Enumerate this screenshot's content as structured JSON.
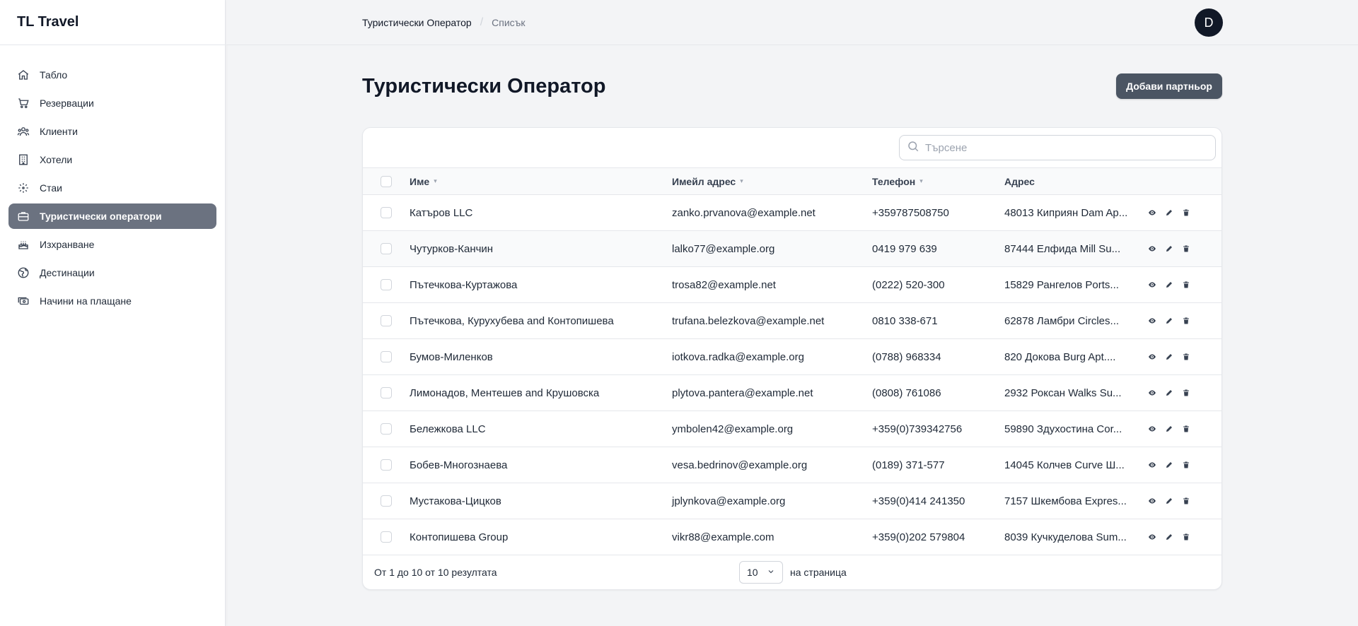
{
  "app": {
    "brand": "TL Travel"
  },
  "sidebar": {
    "items": [
      {
        "label": "Табло",
        "icon": "home-icon",
        "active": false
      },
      {
        "label": "Резервации",
        "icon": "cart-icon",
        "active": false
      },
      {
        "label": "Клиенти",
        "icon": "users-icon",
        "active": false
      },
      {
        "label": "Хотели",
        "icon": "building-icon",
        "active": false
      },
      {
        "label": "Стаи",
        "icon": "rooms-icon",
        "active": false
      },
      {
        "label": "Туристически оператори",
        "icon": "briefcase-icon",
        "active": true
      },
      {
        "label": "Изхранване",
        "icon": "cake-icon",
        "active": false
      },
      {
        "label": "Дестинации",
        "icon": "globe-icon",
        "active": false
      },
      {
        "label": "Начини на плащане",
        "icon": "cash-icon",
        "active": false
      }
    ]
  },
  "header": {
    "breadcrumb": [
      "Туристически Оператор",
      "Списък"
    ],
    "avatar_initial": "D"
  },
  "page": {
    "title": "Туристически Оператор",
    "add_button": "Добави партньор"
  },
  "table": {
    "search_placeholder": "Търсене",
    "columns": [
      "Име",
      "Имейл адрес",
      "Телефон",
      "Адрес"
    ],
    "rows": [
      {
        "name": "Катъров LLC",
        "email": "zanko.prvanova@example.net",
        "phone": "+359787508750",
        "address": "48013 Киприян Dam Ap..."
      },
      {
        "name": "Чутурков-Канчин",
        "email": "lalko77@example.org",
        "phone": "0419 979 639",
        "address": "87444 Елфида Mill Su..."
      },
      {
        "name": "Пътечкова-Куртажова",
        "email": "trosa82@example.net",
        "phone": "(0222) 520-300",
        "address": "15829 Рангелов Ports..."
      },
      {
        "name": "Пътечкова, Курухубева and Контопишева",
        "email": "trufana.belezkova@example.net",
        "phone": "0810 338-671",
        "address": "62878 Ламбри Circles..."
      },
      {
        "name": "Бумов-Миленков",
        "email": "iotkova.radka@example.org",
        "phone": "(0788) 968334",
        "address": "820 Докова Burg Apt...."
      },
      {
        "name": "Лимонадов, Ментешев and Крушовска",
        "email": "plytova.pantera@example.net",
        "phone": "(0808) 761086",
        "address": "2932 Роксан Walks Su..."
      },
      {
        "name": "Бележкова LLC",
        "email": "ymbolen42@example.org",
        "phone": "+359(0)739342756",
        "address": "59890 Здухостина Cor..."
      },
      {
        "name": "Бобев-Многознаева",
        "email": "vesa.bedrinov@example.org",
        "phone": "(0189) 371-577",
        "address": "14045 Колчев Curve Ш..."
      },
      {
        "name": "Мустакова-Цицков",
        "email": "jplynkova@example.org",
        "phone": "+359(0)414 241350",
        "address": "7157 Шкембова Expres..."
      },
      {
        "name": "Контопишева Group",
        "email": "vikr88@example.com",
        "phone": "+359(0)202 579804",
        "address": "8039 Кучкуделова Sum..."
      }
    ],
    "footer": {
      "results": "От 1 до 10 от 10 резултата",
      "per_page_value": "10",
      "per_page_label": "на страница"
    }
  }
}
